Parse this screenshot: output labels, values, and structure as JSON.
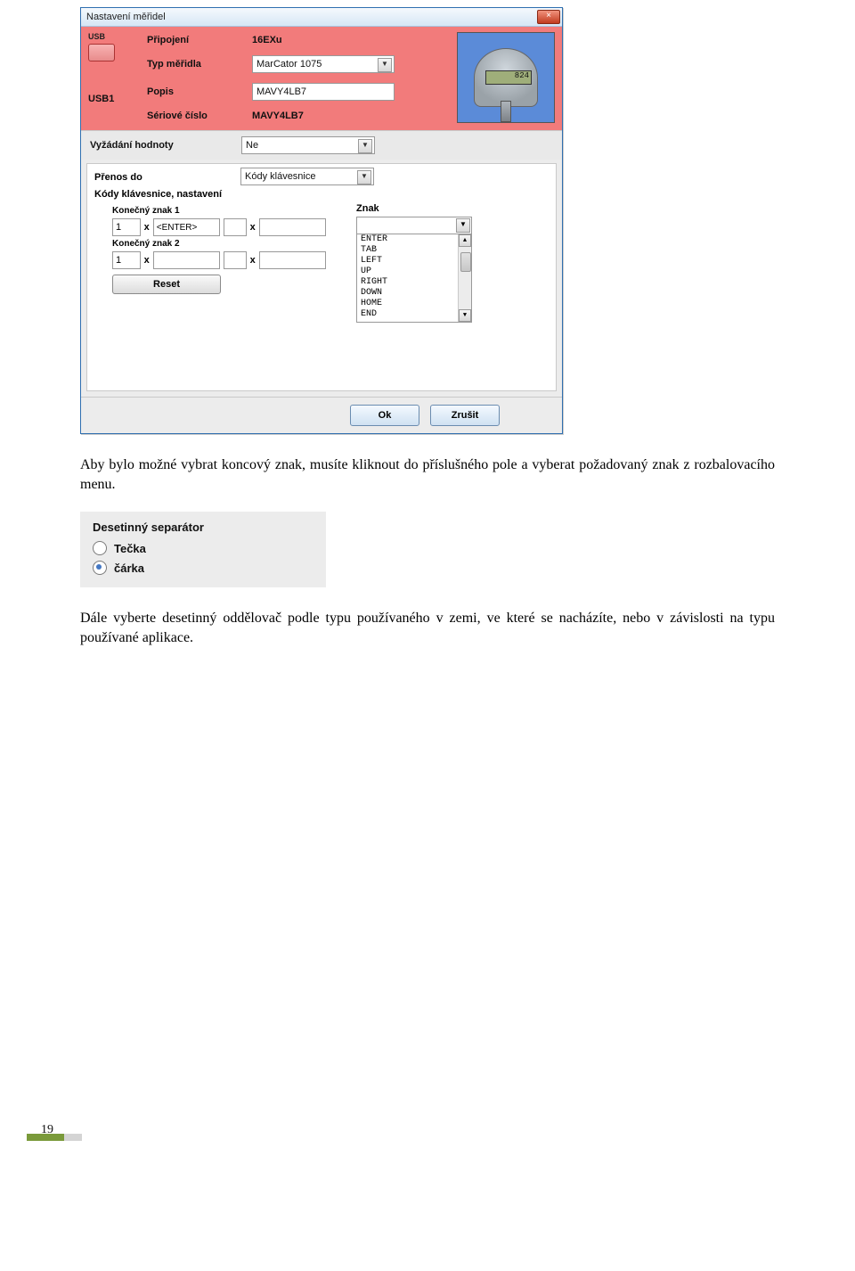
{
  "window": {
    "title": "Nastavení měřidel",
    "close": "×"
  },
  "device": {
    "usb_badge": "USB",
    "usb_port": "USB1",
    "conn_label": "Připojení",
    "conn_value": "16EXu",
    "type_label": "Typ měřidla",
    "type_value": "MarCator 1075",
    "desc_label": "Popis",
    "desc_value": "MAVY4LB7",
    "serial_label": "Sériové číslo",
    "serial_value": "MAVY4LB7",
    "gauge_reading": "824"
  },
  "request": {
    "label": "Vyžádání hodnoty",
    "value": "Ne"
  },
  "transfer": {
    "to_label": "Přenos do",
    "to_value": "Kódy klávesnice",
    "codes_label": "Kódy klávesnice, nastavení",
    "kz1_label": "Konečný znak 1",
    "kz2_label": "Konečný znak 2",
    "count1": "1",
    "x": "x",
    "token1": "<ENTER>",
    "count2": "1",
    "reset": "Reset",
    "znak_label": "Znak",
    "znak_options": [
      "ENTER",
      "TAB",
      "LEFT",
      "UP",
      "RIGHT",
      "DOWN",
      "HOME",
      "END"
    ]
  },
  "buttons": {
    "ok": "Ok",
    "cancel": "Zrušit"
  },
  "text": {
    "p1": "Aby bylo možné vybrat koncový znak, musíte kliknout do příslušného pole a vyberat požadovaný znak z rozbalovacího menu.",
    "p2": "Dále vyberte desetinný oddělovač podle typu používaného v zemi, ve které se nacházíte, nebo v závislosti na typu používané aplikace."
  },
  "separator": {
    "title": "Desetinný separátor",
    "opt1": "Tečka",
    "opt2": "čárka"
  },
  "page_number": "19"
}
